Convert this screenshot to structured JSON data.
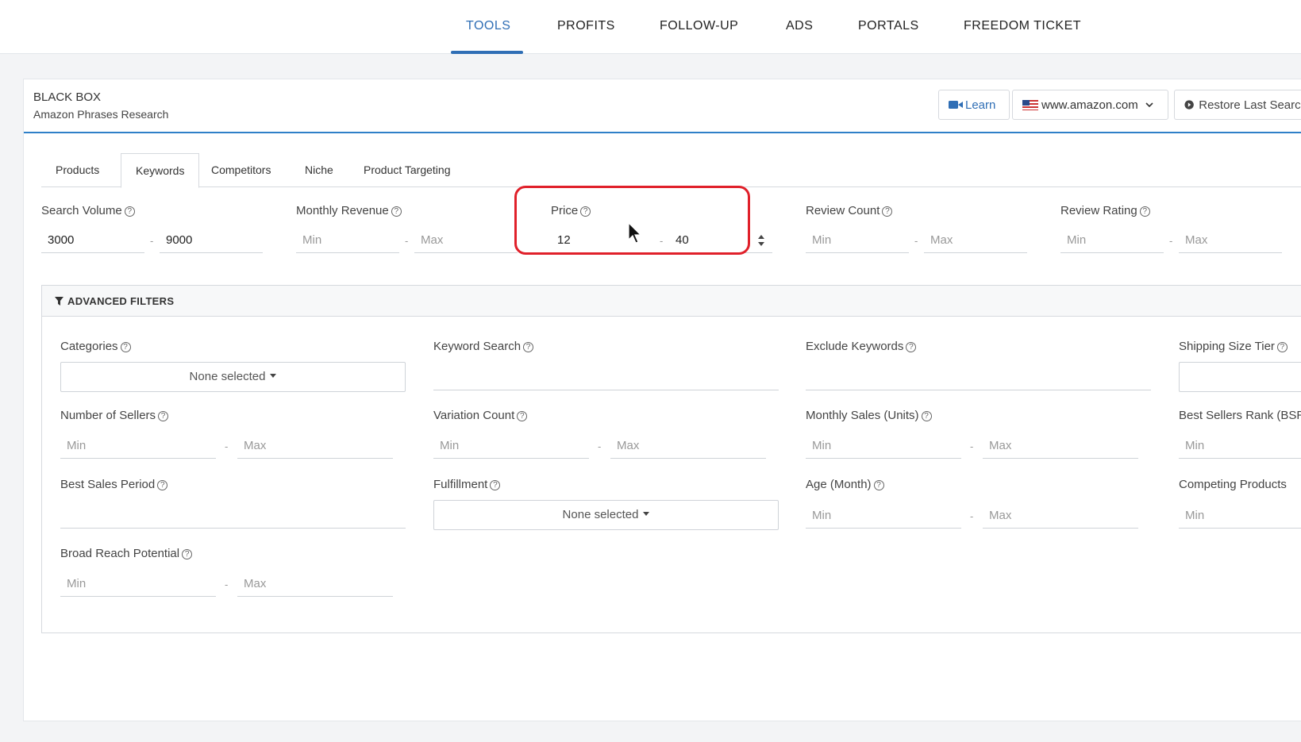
{
  "nav": {
    "items": [
      "TOOLS",
      "PROFITS",
      "FOLLOW-UP",
      "ADS",
      "PORTALS",
      "FREEDOM TICKET"
    ]
  },
  "header": {
    "title": "BLACK BOX",
    "subtitle": "Amazon Phrases Research",
    "learn": "Learn",
    "marketplace": "www.amazon.com",
    "restore": "Restore Last Search"
  },
  "tabs": [
    "Products",
    "Keywords",
    "Competitors",
    "Niche",
    "Product Targeting"
  ],
  "filters": {
    "search_volume": {
      "label": "Search Volume",
      "min": "3000",
      "max": "9000"
    },
    "monthly_revenue": {
      "label": "Monthly Revenue",
      "min": "Min",
      "max": "Max"
    },
    "price": {
      "label": "Price",
      "min": "12",
      "max": "40"
    },
    "review_count": {
      "label": "Review Count",
      "min": "Min",
      "max": "Max"
    },
    "review_rating": {
      "label": "Review Rating",
      "min": "Min",
      "max": "Max"
    }
  },
  "advanced": {
    "title": "ADVANCED FILTERS",
    "categories": {
      "label": "Categories",
      "value": "None selected"
    },
    "keyword_search": {
      "label": "Keyword Search"
    },
    "exclude_keywords": {
      "label": "Exclude Keywords"
    },
    "shipping_size": {
      "label": "Shipping Size Tier"
    },
    "num_sellers": {
      "label": "Number of Sellers",
      "min": "Min",
      "max": "Max"
    },
    "variation_count": {
      "label": "Variation Count",
      "min": "Min",
      "max": "Max"
    },
    "monthly_sales": {
      "label": "Monthly Sales (Units)",
      "min": "Min",
      "max": "Max"
    },
    "bsr": {
      "label": "Best Sellers Rank (BSR)",
      "min": "Min"
    },
    "best_sales_period": {
      "label": "Best Sales Period"
    },
    "fulfillment": {
      "label": "Fulfillment",
      "value": "None selected"
    },
    "age": {
      "label": "Age (Month)",
      "min": "Min",
      "max": "Max"
    },
    "competing": {
      "label": "Competing Products",
      "min": "Min"
    },
    "broad_reach": {
      "label": "Broad Reach Potential",
      "min": "Min",
      "max": "Max"
    }
  },
  "colors": {
    "accent": "#2f6eb5",
    "highlight": "#e0202a"
  }
}
